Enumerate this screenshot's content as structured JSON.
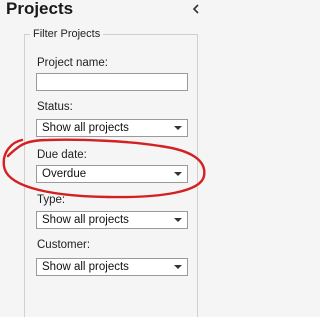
{
  "panel": {
    "title": "Projects",
    "collapse_icon": "chevron-left-icon"
  },
  "filter": {
    "legend": "Filter Projects",
    "project_name": {
      "label": "Project name:",
      "value": "",
      "placeholder": ""
    },
    "status": {
      "label": "Status:",
      "selected": "Show all projects"
    },
    "due_date": {
      "label": "Due date:",
      "selected": "Overdue"
    },
    "type": {
      "label": "Type:",
      "selected": "Show all projects"
    },
    "customer": {
      "label": "Customer:",
      "selected": "Show all projects"
    }
  },
  "annotation": {
    "color": "#d42020"
  }
}
